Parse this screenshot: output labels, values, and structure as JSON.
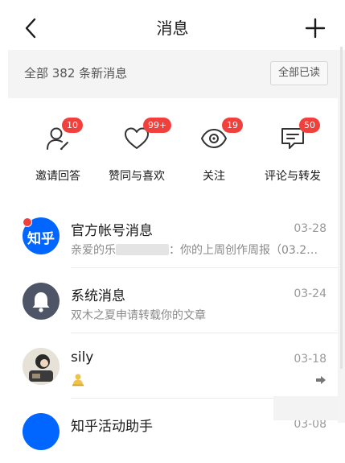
{
  "navbar": {
    "title": "消息",
    "back_icon": "chevron-left-icon",
    "add_icon": "plus-icon"
  },
  "summary": {
    "text": "全部 382 条新消息",
    "mark_all_read": "全部已读"
  },
  "categories": [
    {
      "label": "邀请回答",
      "badge": "10",
      "icon": "invite-answer-icon"
    },
    {
      "label": "赞同与喜欢",
      "badge": "99+",
      "icon": "heart-icon"
    },
    {
      "label": "关注",
      "badge": "19",
      "icon": "eye-icon"
    },
    {
      "label": "评论与转发",
      "badge": "50",
      "icon": "comment-icon"
    }
  ],
  "messages": [
    {
      "name": "官方帐号消息",
      "time": "03-28",
      "preview_before": "亲爱的乐",
      "preview_after": "：你的上周创作周报（03.2…",
      "avatar": "知乎",
      "unread": true
    },
    {
      "name": "系统消息",
      "time": "03-24",
      "preview": "双木之夏申请转载你的文章",
      "avatar_icon": "bell-icon"
    },
    {
      "name": "sily",
      "time": "03-18",
      "preview_icon": "emoji-icon",
      "action_icon": "forward-arrow-icon"
    },
    {
      "name": "知乎活动助手",
      "time": "03-08"
    }
  ],
  "colors": {
    "badge": "#f1403c",
    "brand_blue": "#0066ff",
    "system_avatar": "#4d5566",
    "background_grey": "#f4f4f5"
  }
}
